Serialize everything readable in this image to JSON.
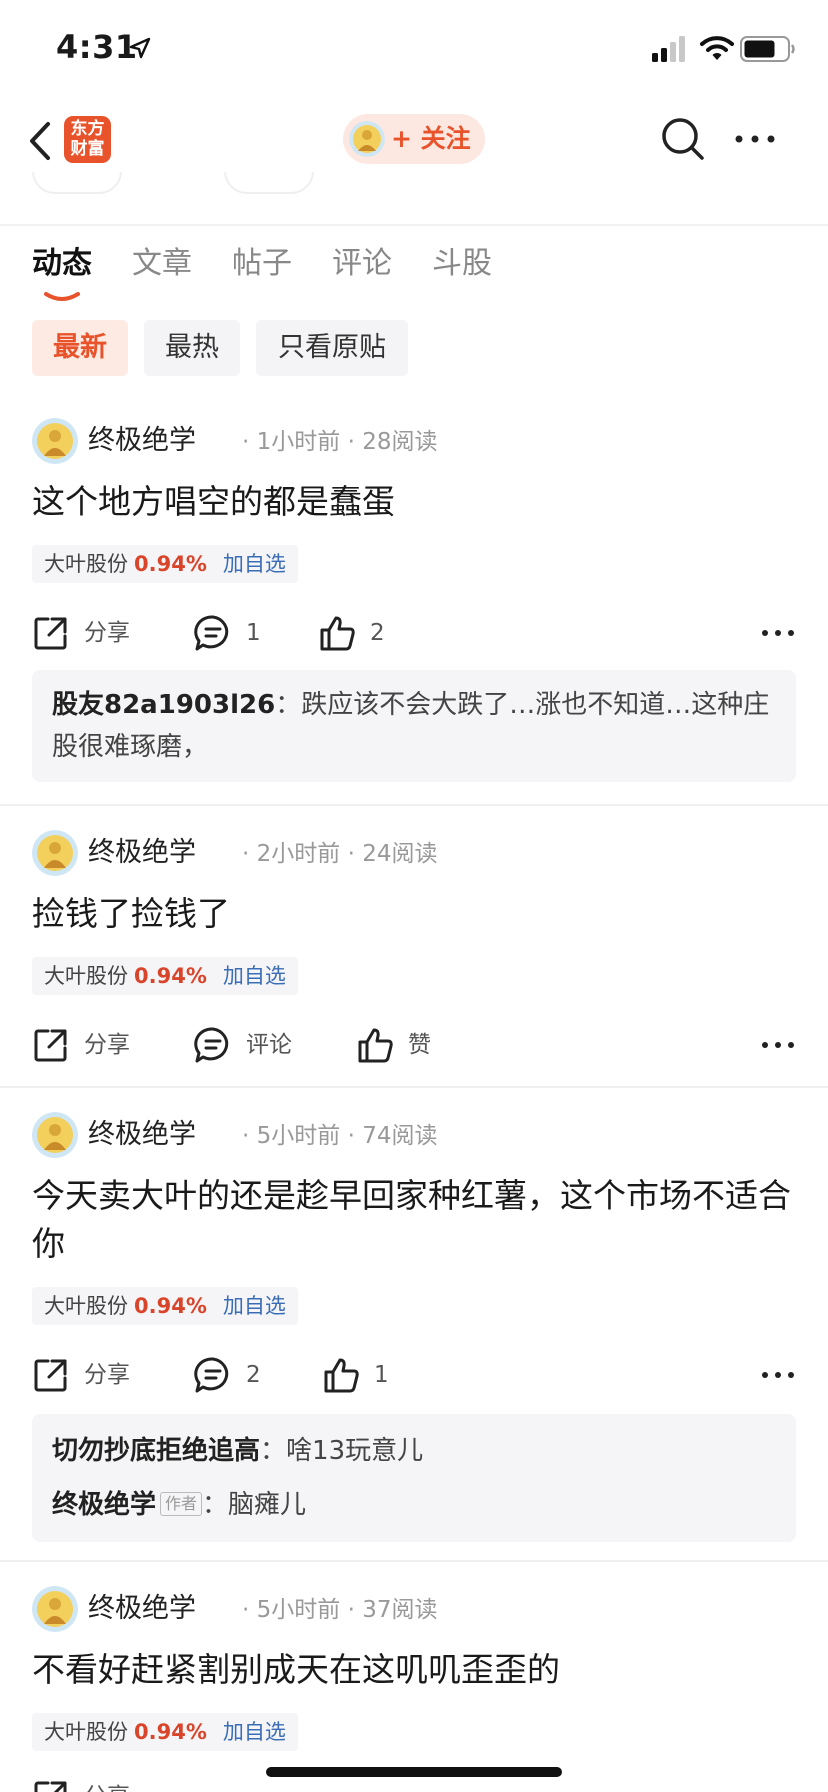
{
  "status": {
    "time": "4:31"
  },
  "nav": {
    "logo_line1": "东方",
    "logo_line2": "财富",
    "follow_label": "+ 关注"
  },
  "tabs": [
    "动态",
    "文章",
    "帖子",
    "评论",
    "斗股"
  ],
  "filters": [
    "最新",
    "最热",
    "只看原贴"
  ],
  "posts": [
    {
      "author": "终极绝学",
      "meta": "· 1小时前 · 28阅读",
      "title": "这个地方唱空的都是蠢蛋",
      "stock": {
        "name": "大叶股份",
        "change": "0.94%",
        "add": "加自选"
      },
      "share": "分享",
      "comments": "1",
      "likes": "2",
      "replies": [
        {
          "user": "股友82a1903l26",
          "sep": "：",
          "text": "跌应该不会大跌了…涨也不知道…这种庄股很难琢磨，"
        }
      ]
    },
    {
      "author": "终极绝学",
      "meta": "· 2小时前 · 24阅读",
      "title": "捡钱了捡钱了",
      "stock": {
        "name": "大叶股份",
        "change": "0.94%",
        "add": "加自选"
      },
      "share": "分享",
      "comments": "评论",
      "likes": "赞"
    },
    {
      "author": "终极绝学",
      "meta": "· 5小时前 · 74阅读",
      "title": "今天卖大叶的还是趁早回家种红薯，这个市场不适合你",
      "stock": {
        "name": "大叶股份",
        "change": "0.94%",
        "add": "加自选"
      },
      "share": "分享",
      "comments": "2",
      "likes": "1",
      "replies": [
        {
          "user": "切勿抄底拒绝追高",
          "sep": "：",
          "text": "啥13玩意儿"
        },
        {
          "user": "终极绝学",
          "tag": "作者",
          "sep": "：",
          "text": "脑瘫儿"
        }
      ]
    },
    {
      "author": "终极绝学",
      "meta": "· 5小时前 · 37阅读",
      "title": "不看好赶紧割别成天在这叽叽歪歪的",
      "stock": {
        "name": "大叶股份",
        "change": "0.94%",
        "add": "加自选"
      },
      "share": "分享"
    }
  ],
  "colors": {
    "brand": "#e8532b",
    "price_up": "#d9452b",
    "link": "#3a6db5"
  }
}
